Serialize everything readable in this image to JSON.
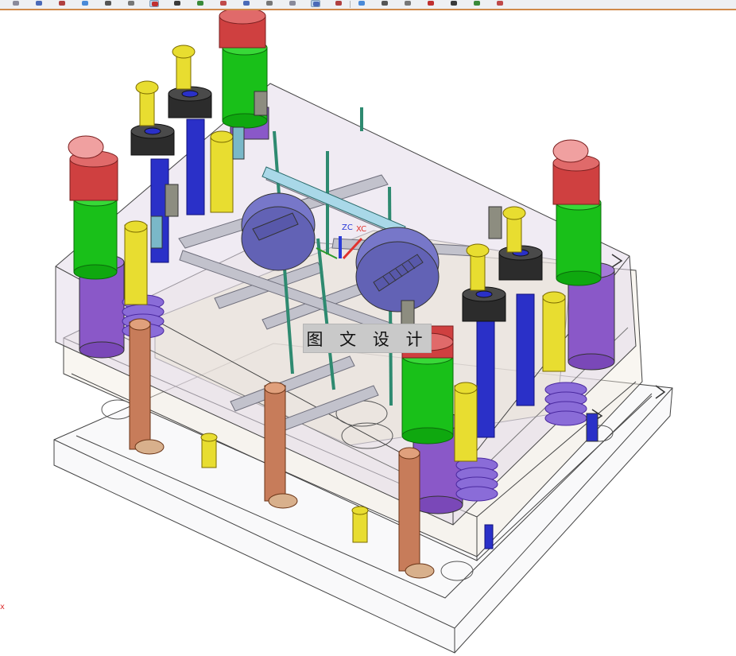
{
  "overlay_label": "图 文 设 计",
  "triad": {
    "z_label": "ZC",
    "x_label": "XC",
    "z_color": "#2a3bd8",
    "x_color": "#e0332e"
  },
  "edge_mark": "x",
  "toolbar": {
    "buttons": [
      "snap-icon",
      "select-icon",
      "wcs-icon",
      "shaded-view-icon",
      "pan-icon",
      "rotate-icon",
      "filter-icon",
      "point-icon",
      "curve-icon",
      "arc-icon",
      "cut-icon",
      "circle-icon",
      "move-icon",
      "measure-icon",
      "orient-icon",
      "layer-icon",
      "view-icon",
      "render-icon",
      "edge-icon",
      "face-icon",
      "section-icon",
      "clip-icon"
    ],
    "active_index": [
      6,
      13
    ]
  },
  "colors": {
    "plate_fill": "#e4daea",
    "plate_edge": "#3a3a3a",
    "green_sleeve": "#18c018",
    "red_cap": "#d54a4a",
    "purple_sleeve": "#8a58c8",
    "yellow_pin": "#e8dd30",
    "copper_pin": "#c77c5a",
    "blue_pin": "#2a30c8",
    "disc": "#7070c8",
    "pipe": "#b9b9c4",
    "bolt_head": "#2e2e2e",
    "accent_toolbar": "#d08a4a"
  }
}
